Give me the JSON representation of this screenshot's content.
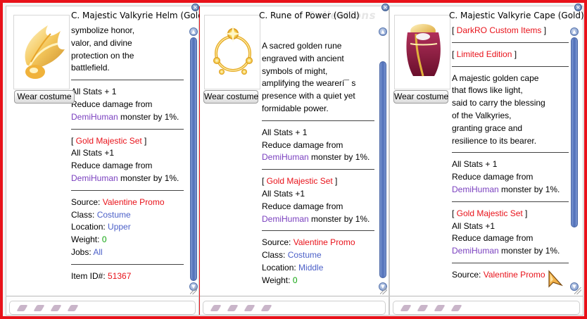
{
  "panels": [
    {
      "title": "C. Majestic Valkyrie Helm (Gold)",
      "wear_label": "Wear costume",
      "portrait_icon": "golden-winged-helm-icon",
      "description": [
        "symbolize honor,",
        "valor, and divine",
        "protection on the",
        "battlefield."
      ],
      "stats": [
        "All Stats + 1",
        "Reduce damage from"
      ],
      "stats_race": "DemiHuman",
      "stats_tail": " monster by 1%.",
      "set_name": "Gold Majestic Set",
      "set_stats": [
        "All Stats +1",
        "Reduce damage from"
      ],
      "set_race": "DemiHuman",
      "set_tail": " monster by 1%.",
      "info": [
        {
          "label": "Source: ",
          "value": "Valentine Promo",
          "color": "red"
        },
        {
          "label": "Class: ",
          "value": "Costume",
          "color": "blue"
        },
        {
          "label": "Location: ",
          "value": "Upper",
          "color": "blue"
        },
        {
          "label": "Weight: ",
          "value": "0",
          "color": "green"
        },
        {
          "label": "Jobs: ",
          "value": "All",
          "color": "blue"
        }
      ],
      "item_id_label": "Item ID#: ",
      "item_id": "51367"
    },
    {
      "title": "C. Rune of Power (Gold)",
      "watermark": "Collections",
      "wear_label": "Wear costume",
      "portrait_icon": "golden-rune-ring-icon",
      "description": [
        "A sacred golden rune",
        "engraved with ancient",
        "symbols of might,",
        "amplifying the wearerí¯ s",
        "presence with a quiet yet",
        "formidable power."
      ],
      "stats": [
        "All Stats + 1",
        "Reduce damage from"
      ],
      "stats_race": "DemiHuman",
      "stats_tail": " monster by 1%.",
      "set_name": "Gold Majestic Set",
      "set_stats": [
        "All Stats +1",
        "Reduce damage from"
      ],
      "set_race": "DemiHuman",
      "set_tail": " monster by 1%.",
      "info": [
        {
          "label": "Source: ",
          "value": "Valentine Promo",
          "color": "red"
        },
        {
          "label": "Class: ",
          "value": "Costume",
          "color": "blue"
        },
        {
          "label": "Location: ",
          "value": "Middle",
          "color": "blue"
        },
        {
          "label": "Weight: ",
          "value": "0",
          "color": "green"
        }
      ]
    },
    {
      "title": "C. Majestic Valkyrie Cape (Gold)",
      "wear_label": "Wear costume",
      "portrait_icon": "golden-cape-icon",
      "tags": [
        "DarkRO Custom Items",
        "Limited Edition"
      ],
      "description": [
        "A majestic golden cape",
        "that flows like light,",
        "said to carry the blessing",
        "of the Valkyries,",
        "granting grace and",
        "resilience to its bearer."
      ],
      "stats": [
        "All Stats + 1",
        "Reduce damage from"
      ],
      "stats_race": "DemiHuman",
      "stats_tail": " monster by 1%.",
      "set_name": "Gold Majestic Set",
      "set_stats": [
        "All Stats +1",
        "Reduce damage from"
      ],
      "set_race": "DemiHuman",
      "set_tail": " monster by 1%.",
      "info": [
        {
          "label": "Source: ",
          "value": "Valentine Promo",
          "color": "red"
        }
      ]
    }
  ],
  "colors": {
    "frame_border": "#e8121a",
    "highlight_red": "#e8121a",
    "race_purple": "#7a40bf",
    "value_blue": "#4c60c8",
    "weight_green": "#11a50e",
    "scroll_blue": "#4f6fb8"
  }
}
